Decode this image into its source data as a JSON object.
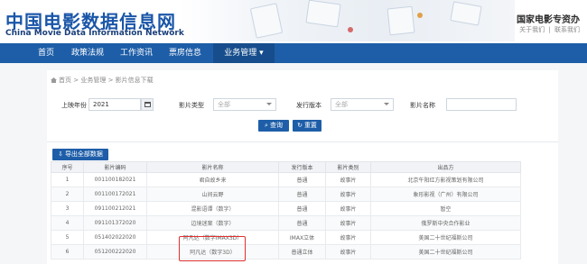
{
  "header": {
    "logo_cn": "中国电影数据信息网",
    "logo_en": "China Movie Data Information Network",
    "org_name": "国家电影专资办",
    "about_link": "关于我们",
    "separator": "|",
    "contact_link": "联系我们"
  },
  "nav": {
    "items": [
      {
        "label": "首页"
      },
      {
        "label": "政策法规"
      },
      {
        "label": "工作资讯"
      },
      {
        "label": "票房信息"
      },
      {
        "label": "业务管理 ▾"
      }
    ]
  },
  "breadcrumb": {
    "home": "首页",
    "sep1": ">",
    "level1": "业务管理",
    "sep2": ">",
    "level2": "影片信息下载"
  },
  "filters": {
    "year_label": "上映年份",
    "year_value": "2021",
    "type_label": "影片类型",
    "type_value": "全部",
    "version_label": "发行版本",
    "version_value": "全部",
    "name_label": "影片名称",
    "name_value": ""
  },
  "buttons": {
    "search_label": "查询",
    "reset_label": "重置",
    "export_label": "导出全部数据"
  },
  "table": {
    "columns": [
      "序号",
      "影片编码",
      "影片名称",
      "发行版本",
      "影片类别",
      "出品方"
    ],
    "rows": [
      [
        "1",
        "001100182021",
        "君自故乡来",
        "普通",
        "故事片",
        "北京午阳红方影视策划有限公司"
      ],
      [
        "2",
        "001100172021",
        "山间云野",
        "普通",
        "故事片",
        "象形影视（广州）有限公司"
      ],
      [
        "3",
        "091100212021",
        "混影语谭（数字）",
        "普通",
        "故事片",
        "暂空"
      ],
      [
        "4",
        "091101372020",
        "边境迷案（数字）",
        "普通",
        "故事片",
        "俄罗斯中央合作影业"
      ],
      [
        "5",
        "051402022020",
        "阿凡达（数字IMAX3D）",
        "IMAX立体",
        "故事片",
        "美国二十世纪福斯公司"
      ],
      [
        "6",
        "051200222020",
        "阿凡达（数字3D）",
        "普通立体",
        "故事片",
        "美国二十世纪福斯公司"
      ]
    ]
  },
  "colors": {
    "nav_bg": "#1e5ea8",
    "brand_blue": "#1a56a8",
    "highlight_red": "#e03030"
  }
}
